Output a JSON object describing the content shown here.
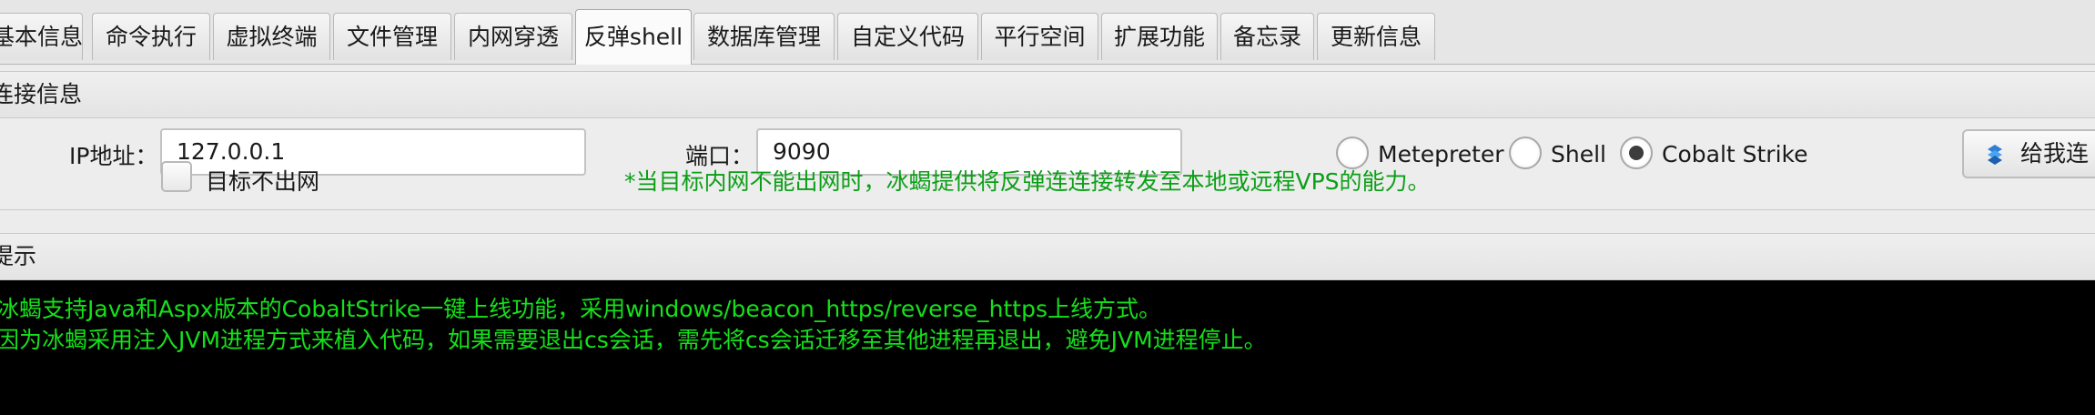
{
  "tabs": [
    {
      "label": "基本信息"
    },
    {
      "label": "命令执行"
    },
    {
      "label": "虚拟终端"
    },
    {
      "label": "文件管理"
    },
    {
      "label": "内网穿透"
    },
    {
      "label": "反弹shell",
      "active": true
    },
    {
      "label": "数据库管理"
    },
    {
      "label": "自定义代码"
    },
    {
      "label": "平行空间"
    },
    {
      "label": "扩展功能"
    },
    {
      "label": "备忘录"
    },
    {
      "label": "更新信息"
    }
  ],
  "connection": {
    "header": "连接信息",
    "ip_label": "IP地址：",
    "ip_value": "127.0.0.1",
    "port_label": "端口：",
    "port_value": "9090",
    "checkbox_label": "目标不出网",
    "hint": "*当目标内网不能出网时，冰蝎提供将反弹连连接转发至本地或远程VPS的能力。",
    "radio_options": [
      {
        "label": "Metepreter",
        "checked": false
      },
      {
        "label": "Shell",
        "checked": false
      },
      {
        "label": "Cobalt Strike",
        "checked": true
      }
    ],
    "connect_button": "给我连"
  },
  "tips": {
    "header": "提示",
    "lines": [
      "冰蝎支持Java和Aspx版本的CobaltStrike一键上线功能，采用windows/beacon_https/reverse_https上线方式。",
      "因为冰蝎采用注入JVM进程方式来植入代码，如果需要退出cs会话，需先将cs会话迁移至其他进程再退出，避免JVM进程停止。"
    ]
  },
  "colors": {
    "hint_green": "#0b9f17",
    "console_bg": "#000000",
    "console_text": "#16e01c"
  }
}
